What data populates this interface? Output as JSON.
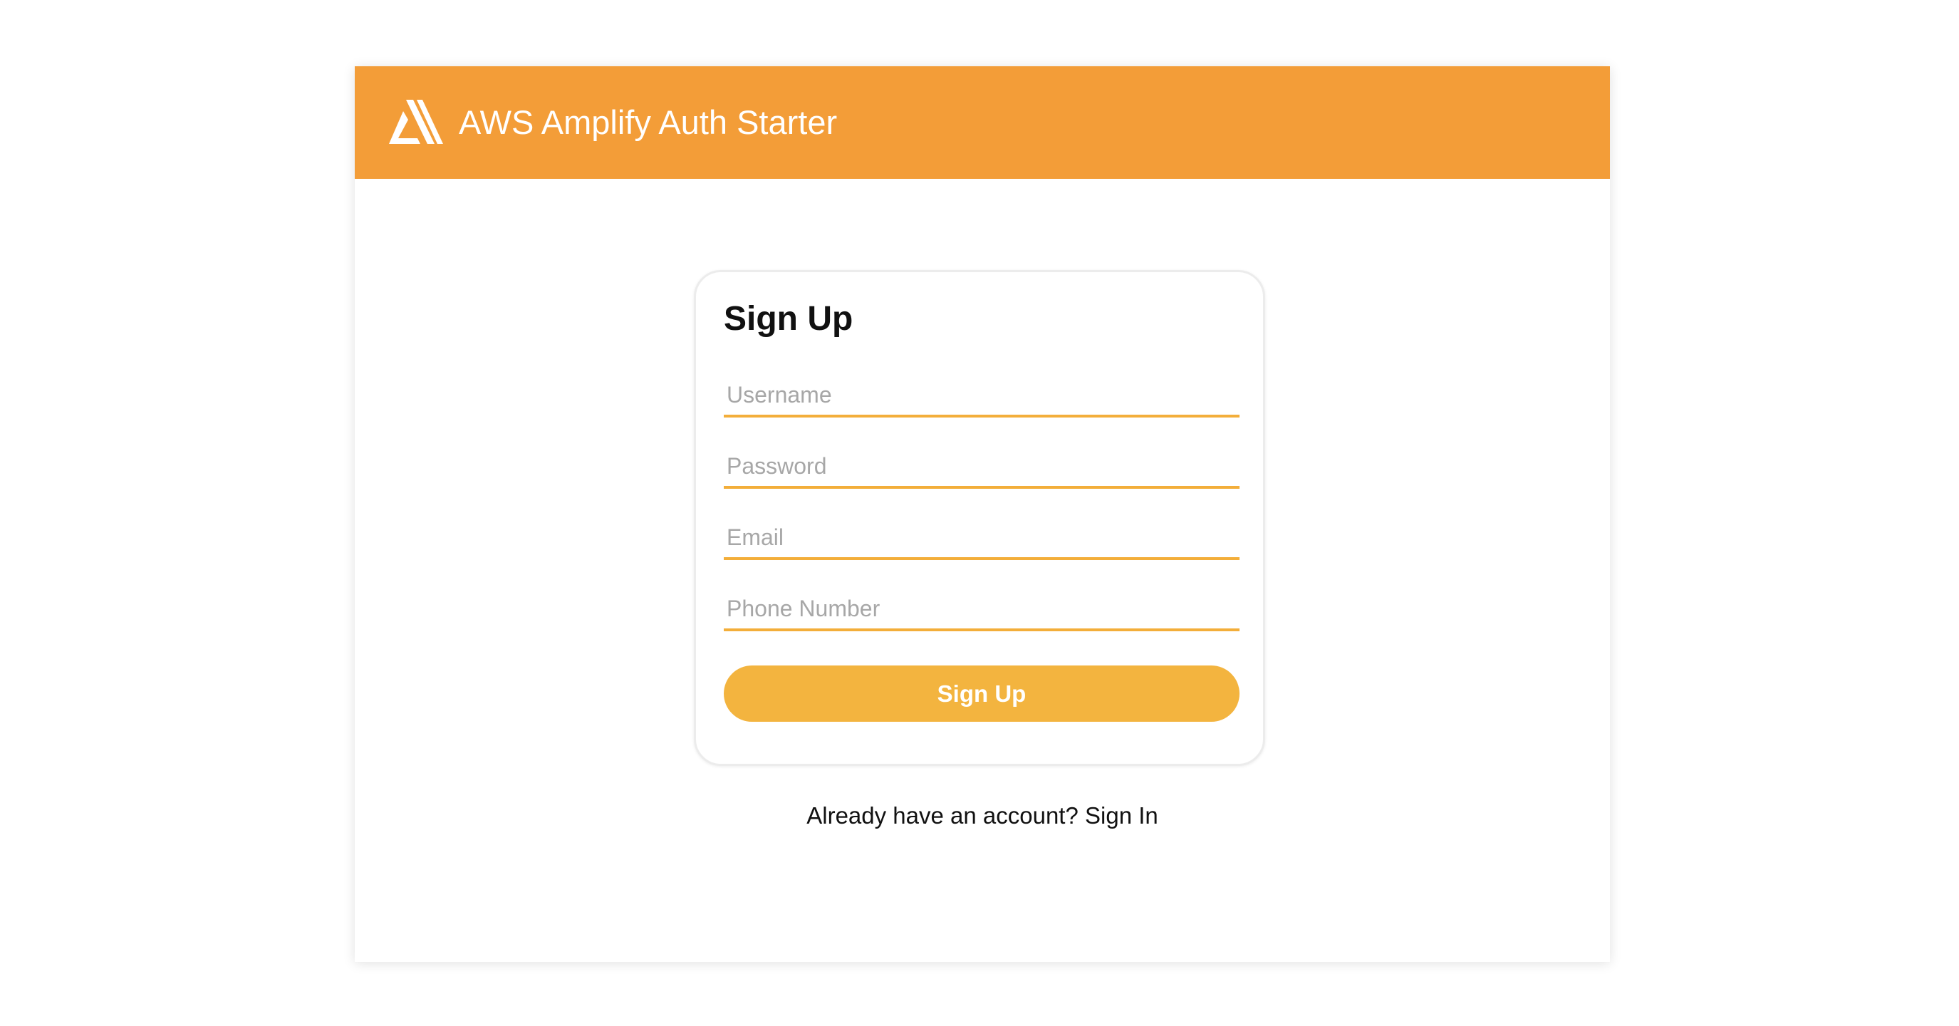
{
  "header": {
    "title": "AWS Amplify Auth Starter",
    "logo_icon": "aws-amplify-logo-icon",
    "background_color": "#f39d38"
  },
  "signup_form": {
    "title": "Sign Up",
    "fields": [
      {
        "name": "username",
        "placeholder": "Username",
        "value": ""
      },
      {
        "name": "password",
        "placeholder": "Password",
        "value": ""
      },
      {
        "name": "email",
        "placeholder": "Email",
        "value": ""
      },
      {
        "name": "phone_number",
        "placeholder": "Phone Number",
        "value": ""
      }
    ],
    "submit_label": "Sign Up",
    "accent_color": "#f3b43f"
  },
  "footer": {
    "prompt_text": "Already have an account?",
    "signin_label": "Sign In"
  }
}
